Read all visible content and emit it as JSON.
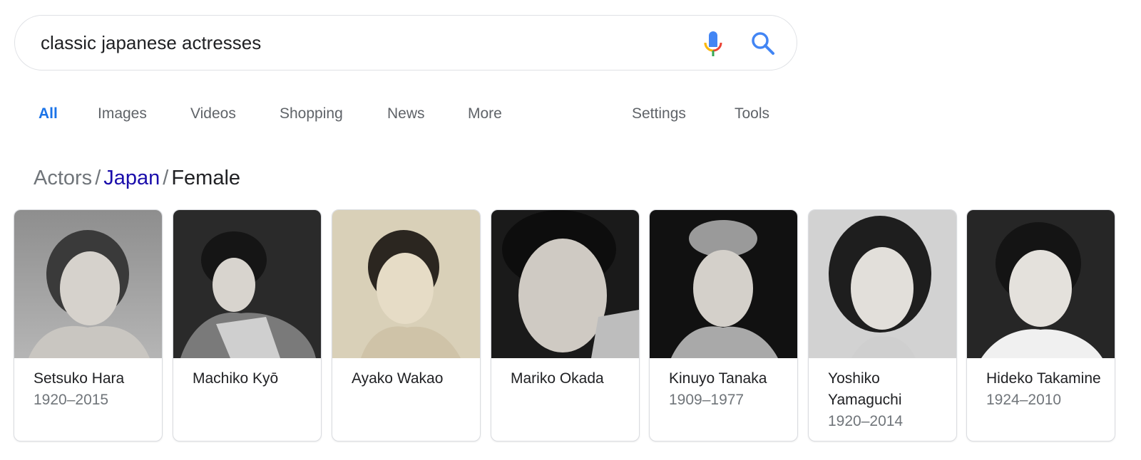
{
  "search": {
    "query": "classic japanese actresses",
    "mic_icon": "microphone-icon",
    "search_icon": "search-icon"
  },
  "tabs": [
    {
      "label": "All",
      "active": true
    },
    {
      "label": "Images"
    },
    {
      "label": "Videos"
    },
    {
      "label": "Shopping"
    },
    {
      "label": "News"
    },
    {
      "label": "More"
    },
    {
      "label": "Settings"
    },
    {
      "label": "Tools"
    }
  ],
  "breadcrumb": {
    "root": "Actors",
    "link": "Japan",
    "current": "Female",
    "separator": "/"
  },
  "cards": [
    {
      "name": "Setsuko Hara",
      "years": "1920–2015"
    },
    {
      "name": "Machiko Kyō",
      "years": ""
    },
    {
      "name": "Ayako Wakao",
      "years": ""
    },
    {
      "name": "Mariko Okada",
      "years": ""
    },
    {
      "name": "Kinuyo Tanaka",
      "years": "1909–1977"
    },
    {
      "name": "Yoshiko Yamaguchi",
      "years": "1920–2014"
    },
    {
      "name": "Hideko Takamine",
      "years": "1924–2010"
    }
  ],
  "colors": {
    "accent": "#1a73e8",
    "link": "#1a0dab",
    "muted": "#70757a",
    "text": "#202124"
  }
}
